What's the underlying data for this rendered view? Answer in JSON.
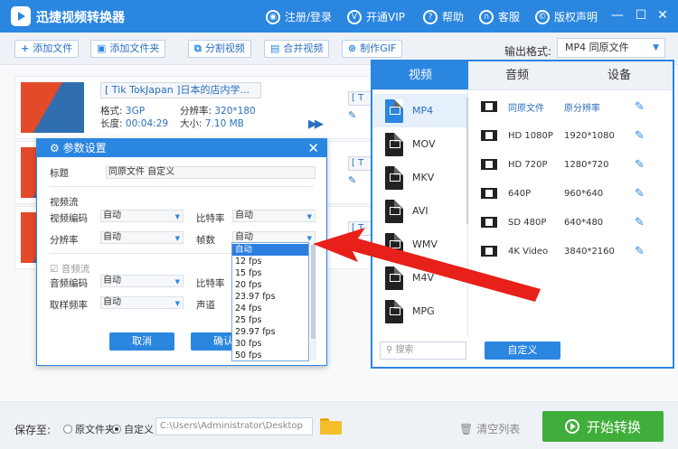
{
  "app": {
    "title": "迅捷视频转换器",
    "links": [
      "注册/登录",
      "开通VIP",
      "帮助",
      "客服",
      "版权声明"
    ]
  },
  "toolbar": {
    "add_file": "添加文件",
    "add_folder": "添加文件夹",
    "split": "分割视频",
    "merge": "合并视频",
    "gif": "制作GIF",
    "output_label": "输出格式:",
    "output_value": "MP4  同原文件"
  },
  "file": {
    "name": "[ Tik TokJapan ]日本的店内学...",
    "format_label": "格式:",
    "format": "3GP",
    "res_label": "分辨率:",
    "res": "320*180",
    "len_label": "长度:",
    "length": "00:04:29",
    "size_label": "大小:",
    "size": "7.10 MB",
    "out_name": "[ T"
  },
  "bottom": {
    "save_to": "保存至:",
    "opt_source": "原文件夹",
    "opt_custom": "自定义",
    "path": "C:\\Users\\Administrator\\Desktop",
    "clear": "清空列表",
    "start": "开始转换"
  },
  "panel": {
    "tabs": [
      "视频",
      "音频",
      "设备"
    ],
    "formats": [
      "MP4",
      "MOV",
      "MKV",
      "AVI",
      "WMV",
      "M4V",
      "MPG"
    ],
    "options": [
      {
        "name": "同原文件",
        "res": "原分辨率"
      },
      {
        "name": "HD 1080P",
        "res": "1920*1080"
      },
      {
        "name": "HD 720P",
        "res": "1280*720"
      },
      {
        "name": "640P",
        "res": "960*640"
      },
      {
        "name": "SD 480P",
        "res": "640*480"
      },
      {
        "name": "4K Video",
        "res": "3840*2160"
      }
    ],
    "search_placeholder": "搜索",
    "custom": "自定义"
  },
  "dialog": {
    "title": "参数设置",
    "name_label": "标题",
    "name_value": "同原文件 自定义",
    "video_section": "视频流",
    "vcodec_label": "视频编码",
    "vcodec": "自动",
    "bitrate_label": "比特率",
    "bitrate": "自动",
    "res_label": "分辨率",
    "res": "自动",
    "fps_label": "帧数",
    "fps": "自动",
    "audio_section": "音频流",
    "acodec_label": "音频编码",
    "acodec": "自动",
    "abitrate_label": "比特率",
    "sample_label": "取样频率",
    "sample": "自动",
    "channel_label": "声道",
    "cancel": "取消",
    "ok": "确认"
  },
  "fps_options": [
    "自动",
    "12 fps",
    "15 fps",
    "20 fps",
    "23.97 fps",
    "24 fps",
    "25 fps",
    "29.97 fps",
    "30 fps",
    "50 fps"
  ],
  "colors": {
    "brand": "#2b86e0",
    "start": "#3fae3a",
    "arrow": "#e8201a"
  }
}
